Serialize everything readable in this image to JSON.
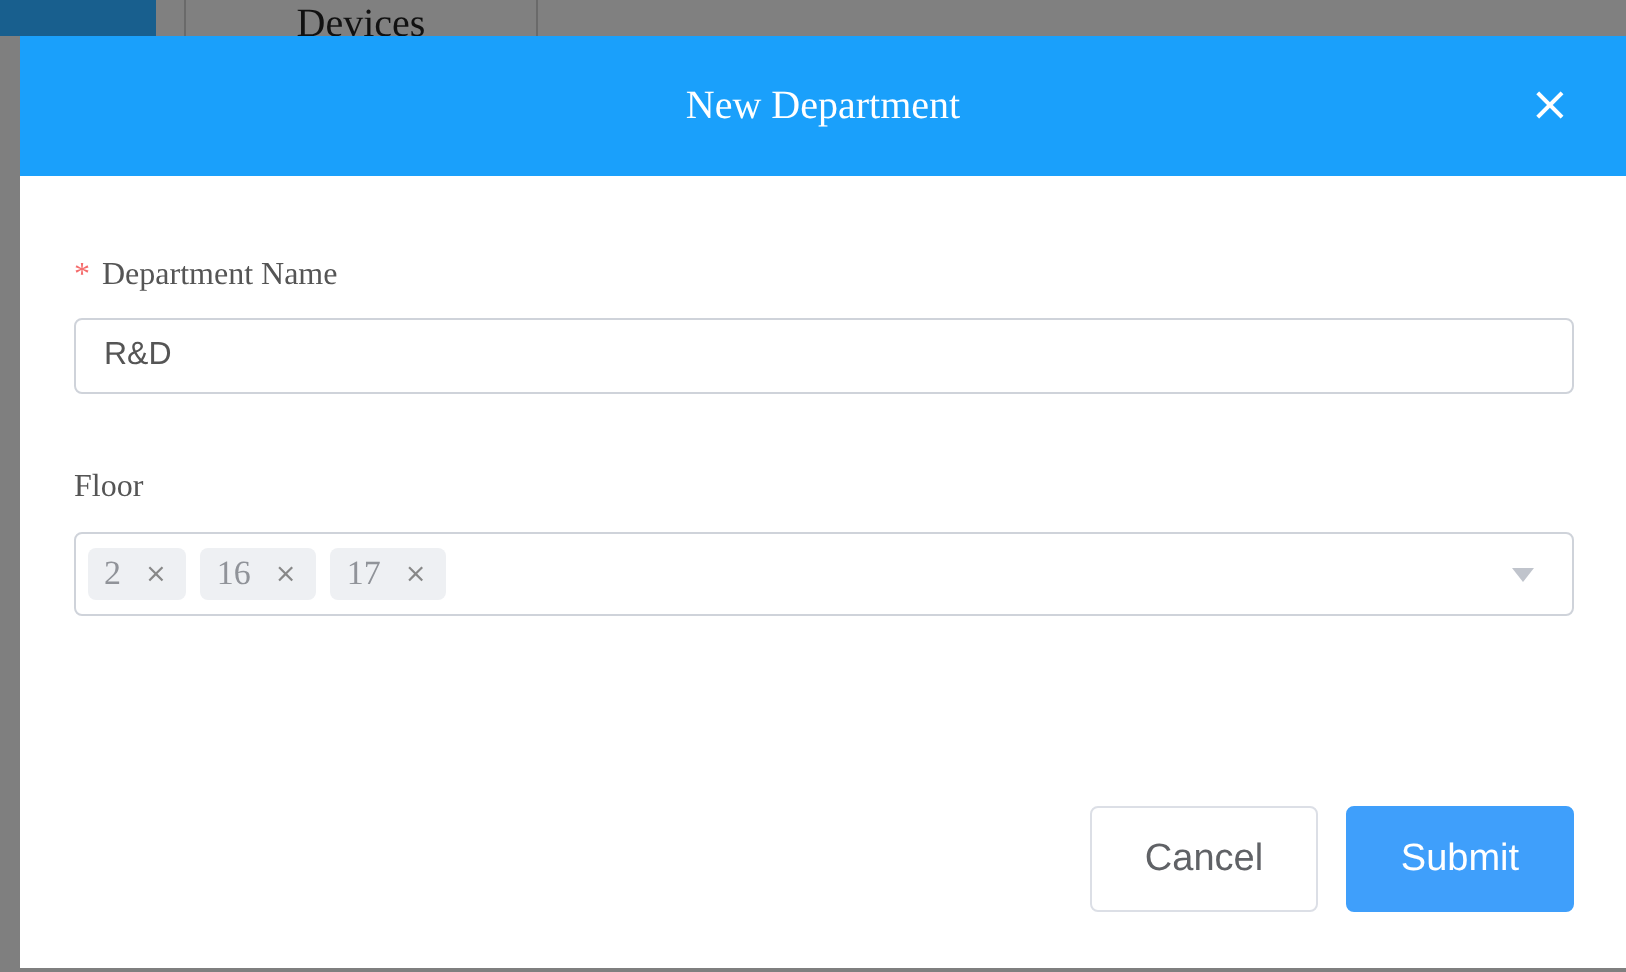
{
  "background": {
    "tabs": [
      {
        "label": "Devices"
      }
    ]
  },
  "dialog": {
    "title": "New Department",
    "close": "×",
    "fields": [
      {
        "kind": "text",
        "label": "Department Name",
        "required_mark": "*",
        "value": "R&D"
      },
      {
        "kind": "tags",
        "label": "Floor",
        "tags": [
          {
            "label": "2",
            "remove": "×"
          },
          {
            "label": "16",
            "remove": "×"
          },
          {
            "label": "17",
            "remove": "×"
          }
        ]
      }
    ],
    "buttons": [
      {
        "label": "Cancel",
        "kind": "secondary"
      },
      {
        "label": "Submit",
        "kind": "primary"
      }
    ]
  }
}
